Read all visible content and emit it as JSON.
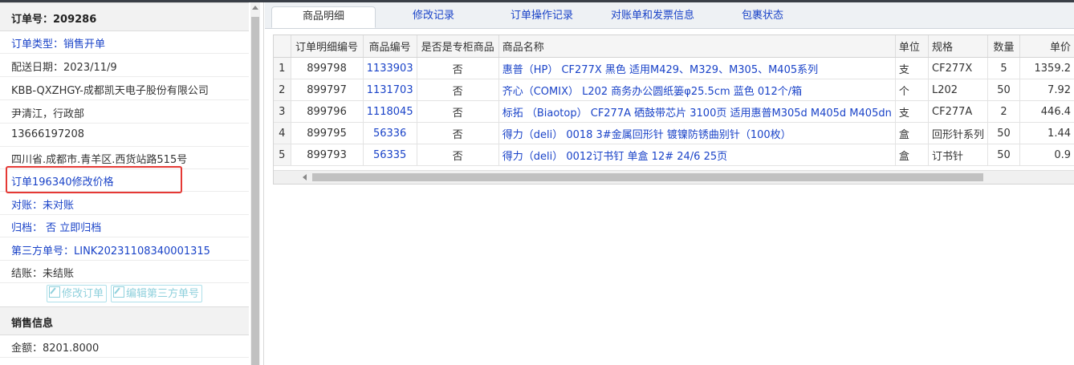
{
  "order": {
    "title": "订单号：209286",
    "fields": [
      {
        "text": "订单类型：销售开单",
        "color": "blue"
      },
      {
        "text": "配送日期：2023/11/9",
        "color": "dark"
      },
      {
        "text": "KBB-QXZHGY-成都凯天电子股份有限公司",
        "color": "dark"
      },
      {
        "text": "尹清江，行政部",
        "color": "dark"
      },
      {
        "text": "13666197208",
        "color": "dark"
      },
      {
        "text": "四川省.成都市.青羊区.西货站路515号",
        "color": "dark"
      },
      {
        "text": "订单196340修改价格",
        "color": "blue"
      },
      {
        "text": "对账：未对账",
        "color": "blue"
      },
      {
        "text": "归档： 否 立即归档",
        "color": "blue"
      },
      {
        "text": "第三方单号：LINK20231108340001315",
        "color": "blue"
      },
      {
        "text": "结账：未结账",
        "color": "dark"
      }
    ],
    "buttons": {
      "edit_order": "修改订单",
      "edit_third_party": "编辑第三方单号"
    }
  },
  "sales": {
    "title": "销售信息",
    "amount": "金额：8201.8000"
  },
  "tabs": [
    "商品明细",
    "修改记录",
    "订单操作记录",
    "对账单和发票信息",
    "包裹状态"
  ],
  "table": {
    "columns": [
      "",
      "订单明细编号",
      "商品编号",
      "是否是专柜商品",
      "商品名称",
      "单位",
      "规格",
      "数量",
      "单价"
    ],
    "rows": [
      [
        "1",
        "899798",
        "1133903",
        "否",
        "惠普（HP） CF277X 黑色 适用M429、M329、M305、M405系列",
        "支",
        "CF277X",
        "5",
        "1359.2"
      ],
      [
        "2",
        "899797",
        "1131703",
        "否",
        "齐心（COMIX） L202 商务办公圆纸篓φ25.5cm 蓝色 012个/箱",
        "个",
        "L202",
        "50",
        "7.92"
      ],
      [
        "3",
        "899796",
        "1118045",
        "否",
        "标拓 （Biaotop） CF277A 硒鼓带芯片 3100页 适用惠普M305d M405d M405dn",
        "支",
        "CF277A",
        "2",
        "446.4"
      ],
      [
        "4",
        "899795",
        "56336",
        "否",
        "得力（deli） 0018 3#金属回形针 镀镍防锈曲别针（100枚）",
        "盒",
        "回形针系列",
        "50",
        "1.44"
      ],
      [
        "5",
        "899793",
        "56335",
        "否",
        "得力（deli） 0012订书钉 单盒 12# 24/6 25页",
        "盒",
        "订书针",
        "50",
        "0.9"
      ]
    ]
  },
  "colors": {
    "link": "#1a43c8",
    "highlight": "#e53935"
  }
}
